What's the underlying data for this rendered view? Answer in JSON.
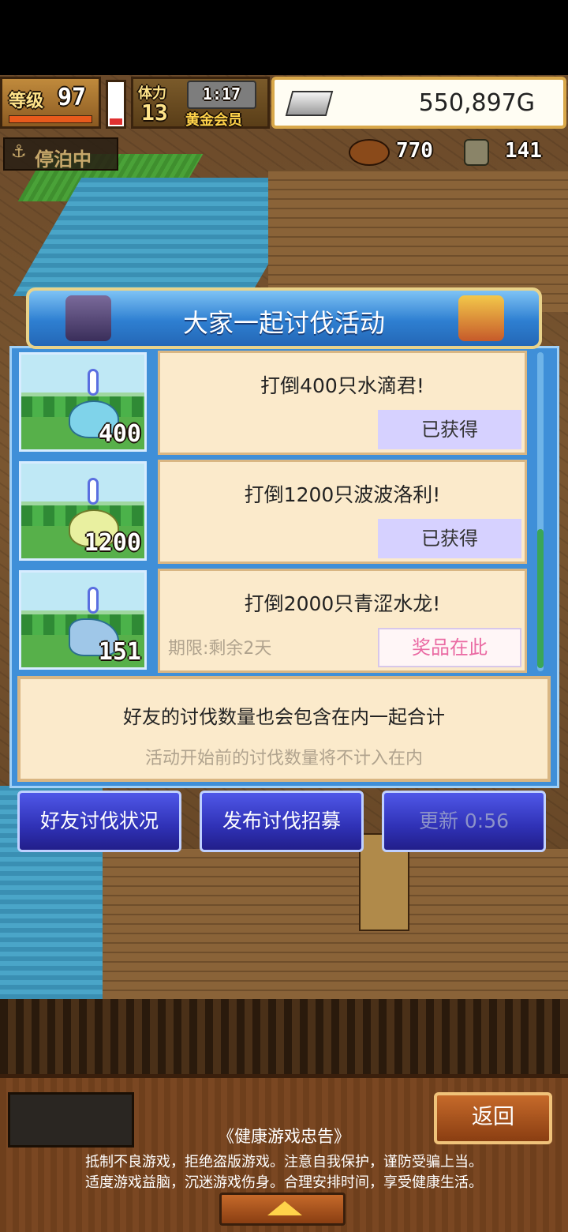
{
  "hud": {
    "level_label": "等级",
    "level_value": "97",
    "stamina_label": "体力",
    "stamina_value": "13",
    "clock": "1:17",
    "vip_label": "黄金会员",
    "gold": "550,897G",
    "status": "停泊中",
    "resource_a": "770",
    "resource_b": "141"
  },
  "modal": {
    "title": "大家一起讨伐活动",
    "quests": [
      {
        "count_badge": "400",
        "title": "打倒400只水滴君!",
        "button": "已获得",
        "deadline": ""
      },
      {
        "count_badge": "1200",
        "title": "打倒1200只波波洛利!",
        "button": "已获得",
        "deadline": ""
      },
      {
        "count_badge": "151",
        "title": "打倒2000只青涩水龙!",
        "button": "奖品在此",
        "deadline": "期限:剩余2天"
      }
    ],
    "info_main": "好友的讨伐数量也会包含在内一起合计",
    "info_sub": "活动开始前的讨伐数量将不计入在内"
  },
  "actions": {
    "friends_status": "好友讨伐状况",
    "post_recruit": "发布讨伐招募",
    "refresh": "更新 0:56"
  },
  "footer": {
    "back": "返回",
    "notice_title": "《健康游戏忠告》",
    "notice_line1": "抵制不良游戏，拒绝盗版游戏。注意自我保护，谨防受骗上当。",
    "notice_line2": "适度游戏益脑，沉迷游戏伤身。合理安排时间，享受健康生活。"
  },
  "colors": {
    "accent_blue": "#3f8fd8",
    "button_blue": "#2f31b5",
    "claimed_bg": "#d6d1ff",
    "prize_pink": "#ea6aa3"
  }
}
